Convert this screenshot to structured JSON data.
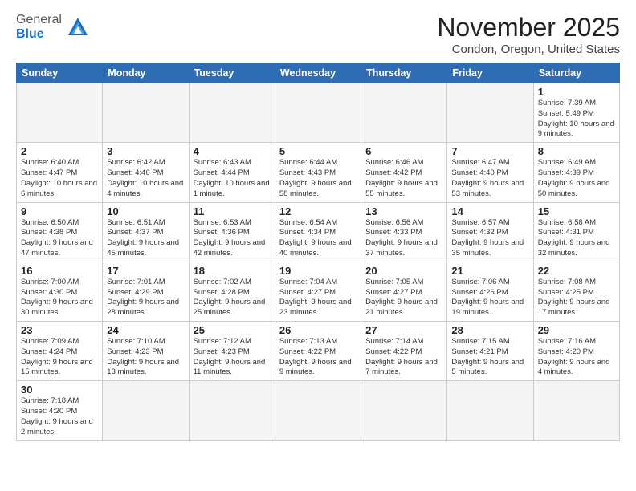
{
  "header": {
    "logo_general": "General",
    "logo_blue": "Blue",
    "title": "November 2025",
    "subtitle": "Condon, Oregon, United States"
  },
  "weekdays": [
    "Sunday",
    "Monday",
    "Tuesday",
    "Wednesday",
    "Thursday",
    "Friday",
    "Saturday"
  ],
  "weeks": [
    [
      {
        "day": "",
        "info": ""
      },
      {
        "day": "",
        "info": ""
      },
      {
        "day": "",
        "info": ""
      },
      {
        "day": "",
        "info": ""
      },
      {
        "day": "",
        "info": ""
      },
      {
        "day": "",
        "info": ""
      },
      {
        "day": "1",
        "info": "Sunrise: 7:39 AM\nSunset: 5:49 PM\nDaylight: 10 hours and 9 minutes."
      }
    ],
    [
      {
        "day": "2",
        "info": "Sunrise: 6:40 AM\nSunset: 4:47 PM\nDaylight: 10 hours and 6 minutes."
      },
      {
        "day": "3",
        "info": "Sunrise: 6:42 AM\nSunset: 4:46 PM\nDaylight: 10 hours and 4 minutes."
      },
      {
        "day": "4",
        "info": "Sunrise: 6:43 AM\nSunset: 4:44 PM\nDaylight: 10 hours and 1 minute."
      },
      {
        "day": "5",
        "info": "Sunrise: 6:44 AM\nSunset: 4:43 PM\nDaylight: 9 hours and 58 minutes."
      },
      {
        "day": "6",
        "info": "Sunrise: 6:46 AM\nSunset: 4:42 PM\nDaylight: 9 hours and 55 minutes."
      },
      {
        "day": "7",
        "info": "Sunrise: 6:47 AM\nSunset: 4:40 PM\nDaylight: 9 hours and 53 minutes."
      },
      {
        "day": "8",
        "info": "Sunrise: 6:49 AM\nSunset: 4:39 PM\nDaylight: 9 hours and 50 minutes."
      }
    ],
    [
      {
        "day": "9",
        "info": "Sunrise: 6:50 AM\nSunset: 4:38 PM\nDaylight: 9 hours and 47 minutes."
      },
      {
        "day": "10",
        "info": "Sunrise: 6:51 AM\nSunset: 4:37 PM\nDaylight: 9 hours and 45 minutes."
      },
      {
        "day": "11",
        "info": "Sunrise: 6:53 AM\nSunset: 4:36 PM\nDaylight: 9 hours and 42 minutes."
      },
      {
        "day": "12",
        "info": "Sunrise: 6:54 AM\nSunset: 4:34 PM\nDaylight: 9 hours and 40 minutes."
      },
      {
        "day": "13",
        "info": "Sunrise: 6:56 AM\nSunset: 4:33 PM\nDaylight: 9 hours and 37 minutes."
      },
      {
        "day": "14",
        "info": "Sunrise: 6:57 AM\nSunset: 4:32 PM\nDaylight: 9 hours and 35 minutes."
      },
      {
        "day": "15",
        "info": "Sunrise: 6:58 AM\nSunset: 4:31 PM\nDaylight: 9 hours and 32 minutes."
      }
    ],
    [
      {
        "day": "16",
        "info": "Sunrise: 7:00 AM\nSunset: 4:30 PM\nDaylight: 9 hours and 30 minutes."
      },
      {
        "day": "17",
        "info": "Sunrise: 7:01 AM\nSunset: 4:29 PM\nDaylight: 9 hours and 28 minutes."
      },
      {
        "day": "18",
        "info": "Sunrise: 7:02 AM\nSunset: 4:28 PM\nDaylight: 9 hours and 25 minutes."
      },
      {
        "day": "19",
        "info": "Sunrise: 7:04 AM\nSunset: 4:27 PM\nDaylight: 9 hours and 23 minutes."
      },
      {
        "day": "20",
        "info": "Sunrise: 7:05 AM\nSunset: 4:27 PM\nDaylight: 9 hours and 21 minutes."
      },
      {
        "day": "21",
        "info": "Sunrise: 7:06 AM\nSunset: 4:26 PM\nDaylight: 9 hours and 19 minutes."
      },
      {
        "day": "22",
        "info": "Sunrise: 7:08 AM\nSunset: 4:25 PM\nDaylight: 9 hours and 17 minutes."
      }
    ],
    [
      {
        "day": "23",
        "info": "Sunrise: 7:09 AM\nSunset: 4:24 PM\nDaylight: 9 hours and 15 minutes."
      },
      {
        "day": "24",
        "info": "Sunrise: 7:10 AM\nSunset: 4:23 PM\nDaylight: 9 hours and 13 minutes."
      },
      {
        "day": "25",
        "info": "Sunrise: 7:12 AM\nSunset: 4:23 PM\nDaylight: 9 hours and 11 minutes."
      },
      {
        "day": "26",
        "info": "Sunrise: 7:13 AM\nSunset: 4:22 PM\nDaylight: 9 hours and 9 minutes."
      },
      {
        "day": "27",
        "info": "Sunrise: 7:14 AM\nSunset: 4:22 PM\nDaylight: 9 hours and 7 minutes."
      },
      {
        "day": "28",
        "info": "Sunrise: 7:15 AM\nSunset: 4:21 PM\nDaylight: 9 hours and 5 minutes."
      },
      {
        "day": "29",
        "info": "Sunrise: 7:16 AM\nSunset: 4:20 PM\nDaylight: 9 hours and 4 minutes."
      }
    ],
    [
      {
        "day": "30",
        "info": "Sunrise: 7:18 AM\nSunset: 4:20 PM\nDaylight: 9 hours and 2 minutes."
      },
      {
        "day": "",
        "info": ""
      },
      {
        "day": "",
        "info": ""
      },
      {
        "day": "",
        "info": ""
      },
      {
        "day": "",
        "info": ""
      },
      {
        "day": "",
        "info": ""
      },
      {
        "day": "",
        "info": ""
      }
    ]
  ]
}
